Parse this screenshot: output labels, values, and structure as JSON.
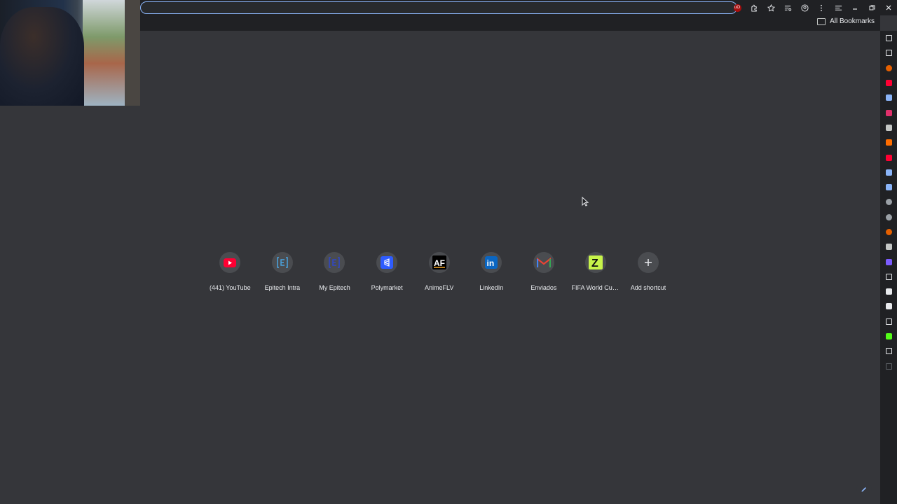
{
  "toolbar": {
    "omnibox_value": "",
    "icons": [
      "ublock-icon",
      "extensions-icon",
      "bookmark-star-icon",
      "tab-search-icon",
      "profile-icon",
      "menu-icon",
      "side-panel-icon",
      "minimize-icon",
      "restore-icon",
      "close-icon"
    ]
  },
  "bookmarks_bar": {
    "all_bookmarks": "All Bookmarks"
  },
  "shortcuts": [
    {
      "label": "(441) YouTube",
      "icon": "youtube-icon"
    },
    {
      "label": "Epitech Intra",
      "icon": "epitech-intra-icon"
    },
    {
      "label": "My Epitech",
      "icon": "my-epitech-icon"
    },
    {
      "label": "Polymarket",
      "icon": "polymarket-icon"
    },
    {
      "label": "AnimeFLV",
      "icon": "animeflv-icon"
    },
    {
      "label": "LinkedIn",
      "icon": "linkedin-icon"
    },
    {
      "label": "Enviados",
      "icon": "gmail-icon"
    },
    {
      "label": "FIFA World Cup...",
      "icon": "fifa-icon"
    },
    {
      "label": "Add shortcut",
      "icon": "plus-icon"
    }
  ],
  "side_panel": {
    "icons": [
      "x-icon",
      "x-icon",
      "firefox-icon",
      "youtube-icon",
      "gemini-icon",
      "instagram-icon",
      "trash-icon",
      "orange-app-icon",
      "youtube-icon",
      "gemini-icon",
      "gemini-icon",
      "globe-icon",
      "globe-icon",
      "firefox-icon",
      "notes-icon",
      "proton-mail-icon",
      "capcut-icon",
      "mail-icon",
      "mail-icon",
      "capcut-icon",
      "kick-icon",
      "asterisk-icon",
      "add-icon"
    ]
  },
  "colors": {
    "page_bg": "#35363a",
    "toolbar_bg": "#202124",
    "accent": "#8ab4f8"
  }
}
